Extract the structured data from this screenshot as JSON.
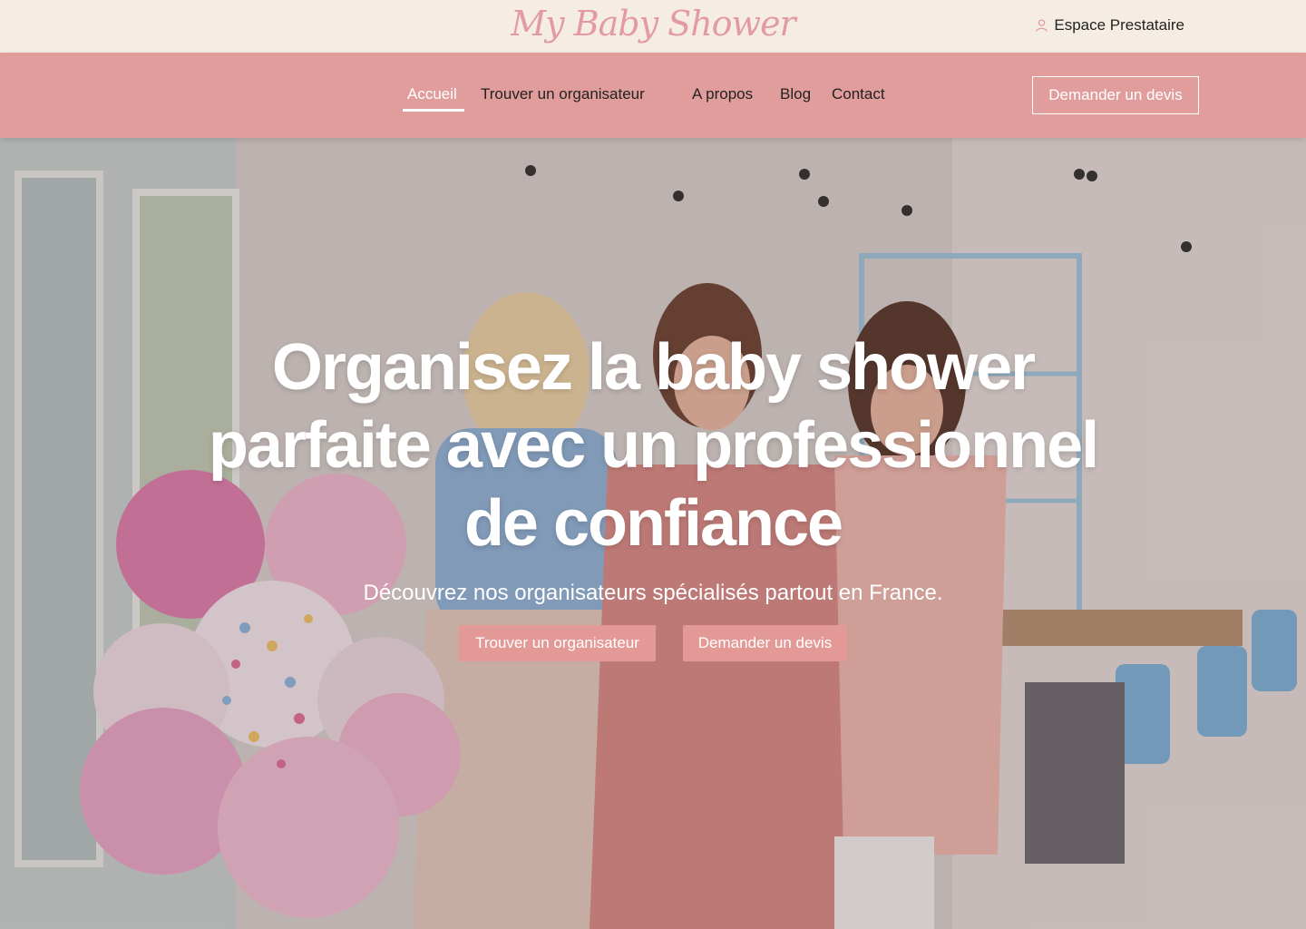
{
  "header": {
    "logo": "My Baby Shower",
    "espace_prestataire": "Espace Prestataire"
  },
  "nav": {
    "items": [
      {
        "label": "Accueil",
        "active": true
      },
      {
        "label": "Trouver un organisateur",
        "active": false
      },
      {
        "label": "A propos",
        "active": false
      },
      {
        "label": "Blog",
        "active": false
      },
      {
        "label": "Contact",
        "active": false
      }
    ],
    "cta": "Demander un devis"
  },
  "hero": {
    "title_line1": "Organisez la baby shower",
    "title_line2": "parfaite avec un professionnel",
    "title_line3": "de confiance",
    "subtitle": "Découvrez nos organisateurs spécialisés partout en France.",
    "button_primary": "Trouver un organisateur",
    "button_secondary": "Demander un devis"
  },
  "colors": {
    "topbar_bg": "#f5ede3",
    "nav_bg": "#e19d9b",
    "accent": "#e39a97",
    "logo": "#e39aa0"
  },
  "icons": {
    "espace": "user-icon"
  }
}
